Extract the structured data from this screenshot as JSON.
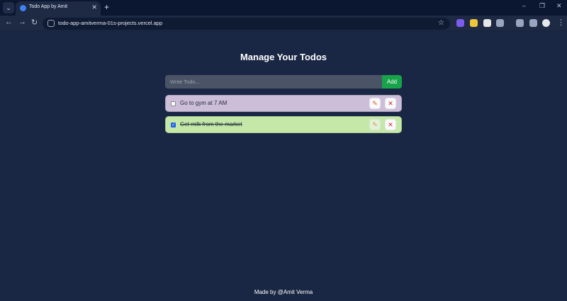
{
  "browser": {
    "tab_title": "Todo App by Amit",
    "tab_favicon_text": "",
    "url": "todo-app-amitverma-01s-projects.vercel.app"
  },
  "app": {
    "heading": "Manage Your Todos",
    "input_placeholder": "Write Todo...",
    "input_value": "",
    "add_label": "Add",
    "todos": [
      {
        "text": "Go to gym at 7 AM",
        "completed": false
      },
      {
        "text": "Get milk from the market",
        "completed": true
      }
    ],
    "footer": "Made by @Amit Verma"
  },
  "colors": {
    "background": "#1a2744",
    "pending_todo": "#ccbed9",
    "completed_todo": "#c5e8a9",
    "add_button": "#16a34a"
  },
  "icons": {
    "edit": "pencil-icon",
    "delete": "close-icon"
  }
}
